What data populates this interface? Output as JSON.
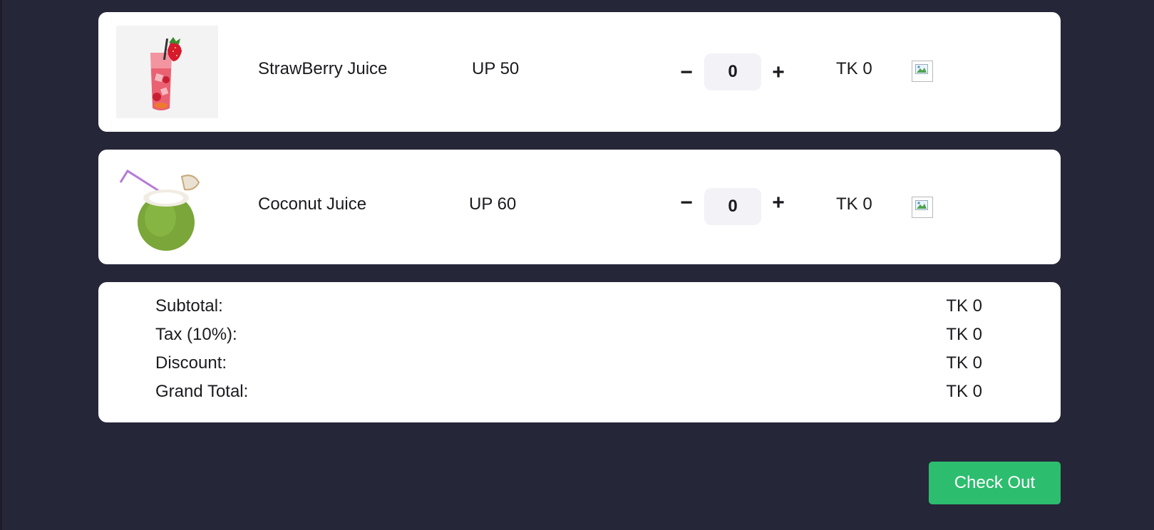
{
  "cart": {
    "items": [
      {
        "name": "StrawBerry Juice",
        "unit_price": "UP 50",
        "quantity": "0",
        "line_total": "TK 0",
        "decrement_label": "−",
        "increment_label": "+",
        "image": "strawberry-juice-glass"
      },
      {
        "name": "Coconut Juice",
        "unit_price": "UP 60",
        "quantity": "0",
        "line_total": "TK 0",
        "decrement_label": "−",
        "increment_label": "+",
        "image": "coconut-with-straw"
      }
    ]
  },
  "summary": {
    "rows": [
      {
        "label": "Subtotal:",
        "value": "TK 0"
      },
      {
        "label": "Tax (10%):",
        "value": "TK 0"
      },
      {
        "label": "Discount:",
        "value": "TK 0"
      },
      {
        "label": "Grand Total:",
        "value": "TK 0"
      }
    ]
  },
  "checkout": {
    "label": "Check Out"
  },
  "colors": {
    "background": "#262639",
    "card": "#ffffff",
    "quantity_box": "#f2f2f7",
    "checkout_button": "#2dbd6e",
    "text": "#1b1b1f"
  }
}
